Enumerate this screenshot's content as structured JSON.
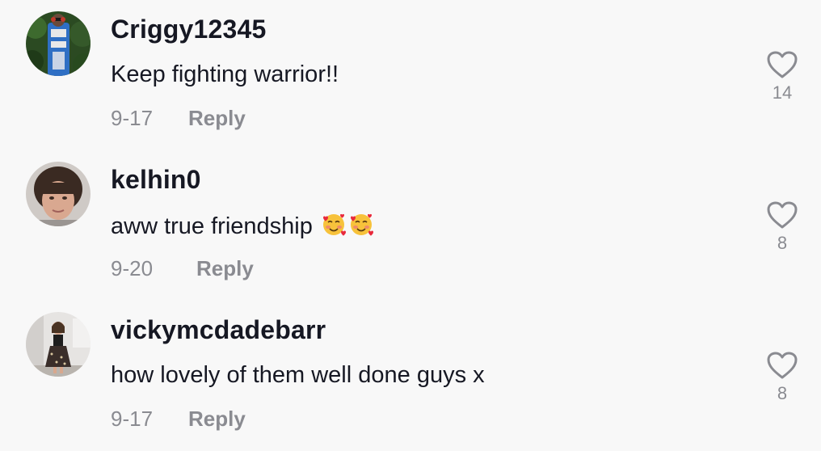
{
  "comments": [
    {
      "username": "Criggy12345",
      "text": "Keep fighting warrior!!",
      "date": "9-17",
      "reply_label": "Reply",
      "likes": "14",
      "avatar": "avatar-costume-photo"
    },
    {
      "username": "kelhin0",
      "text": "aww true friendship",
      "emoji": [
        "smiling-face-with-hearts",
        "smiling-face-with-hearts"
      ],
      "date": "9-20",
      "reply_label": "Reply",
      "likes": "8",
      "avatar": "avatar-woman-photo"
    },
    {
      "username": "vickymcdadebarr",
      "text": "how lovely of them well done guys x",
      "date": "9-17",
      "reply_label": "Reply",
      "likes": "8",
      "avatar": "avatar-girl-dress-photo"
    }
  ],
  "colors": {
    "background": "#f8f8f8",
    "username": "#161823",
    "secondary": "#8a8b91"
  }
}
